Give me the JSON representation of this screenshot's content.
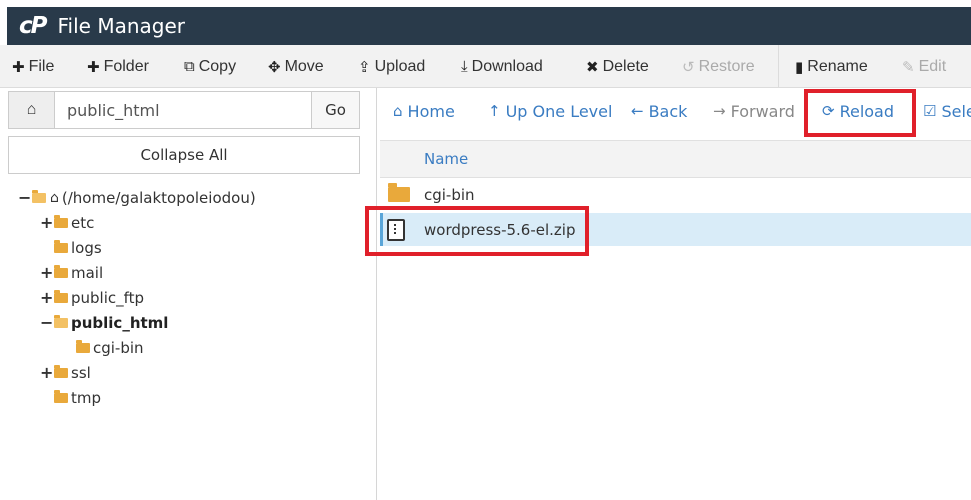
{
  "app": {
    "logo": "cP",
    "title": "File Manager"
  },
  "toolbar": {
    "file": "File",
    "folder": "Folder",
    "copy": "Copy",
    "move": "Move",
    "upload": "Upload",
    "download": "Download",
    "delete": "Delete",
    "restore": "Restore",
    "rename": "Rename",
    "edit": "Edit"
  },
  "path": {
    "value": "public_html",
    "go_label": "Go"
  },
  "collapse_label": "Collapse All",
  "tree": {
    "root": "(/home/galaktopoleiodou)",
    "items": [
      "etc",
      "logs",
      "mail",
      "public_ftp",
      "public_html",
      "cgi-bin",
      "ssl",
      "tmp"
    ],
    "toggles": {
      "root": "−",
      "etc": "+",
      "mail": "+",
      "public_ftp": "+",
      "public_html": "−",
      "ssl": "+"
    }
  },
  "nav": {
    "home": "Home",
    "up": "Up One Level",
    "back": "Back",
    "forward": "Forward",
    "reload": "Reload",
    "select": "Sele"
  },
  "list": {
    "column_name": "Name",
    "files": [
      {
        "name": "cgi-bin",
        "type": "folder-icon"
      },
      {
        "name": "wordpress-5.6-el.zip",
        "type": "zip-file-icon"
      }
    ]
  },
  "colors": {
    "titlebar": "#293a4a",
    "link": "#3a7cc2",
    "folder": "#e9a93b",
    "highlight": "#e0202a",
    "selected_row": "#d9ecf8"
  }
}
